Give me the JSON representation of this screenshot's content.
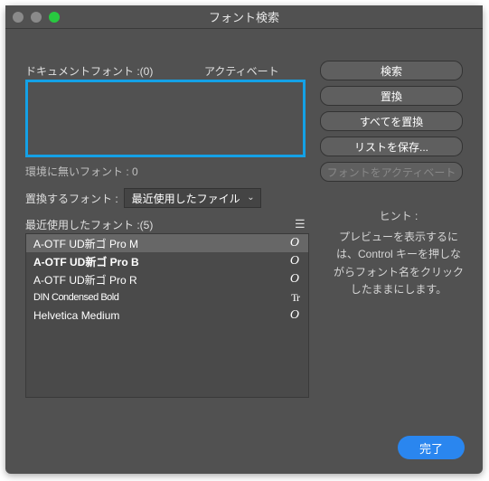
{
  "window": {
    "title": "フォント検索"
  },
  "labels": {
    "documentFont": "ドキュメントフォント :(0)",
    "activate": "アクティベート",
    "missingFonts": "環境に無いフォント : 0",
    "replaceFont": "置換するフォント :",
    "recentFonts": "最近使用したフォント :(5)"
  },
  "select": {
    "value": "最近使用したファイル"
  },
  "buttons": {
    "search": "検索",
    "replace": "置換",
    "replaceAll": "すべてを置換",
    "saveList": "リストを保存...",
    "activateFont": "フォントをアクティベート",
    "done": "完了"
  },
  "hint": {
    "title": "ヒント :",
    "body": "プレビューを表示するには、Control キーを押しながらフォント名をクリックしたままにします。"
  },
  "fonts": [
    {
      "name": "A-OTF UD新ゴ Pro M",
      "glyph": "O"
    },
    {
      "name": "A-OTF UD新ゴ Pro B",
      "glyph": "O"
    },
    {
      "name": "A-OTF UD新ゴ Pro R",
      "glyph": "O"
    },
    {
      "name": "DIN Condensed Bold",
      "glyph": "Tr"
    },
    {
      "name": "Helvetica Medium",
      "glyph": "O"
    }
  ]
}
